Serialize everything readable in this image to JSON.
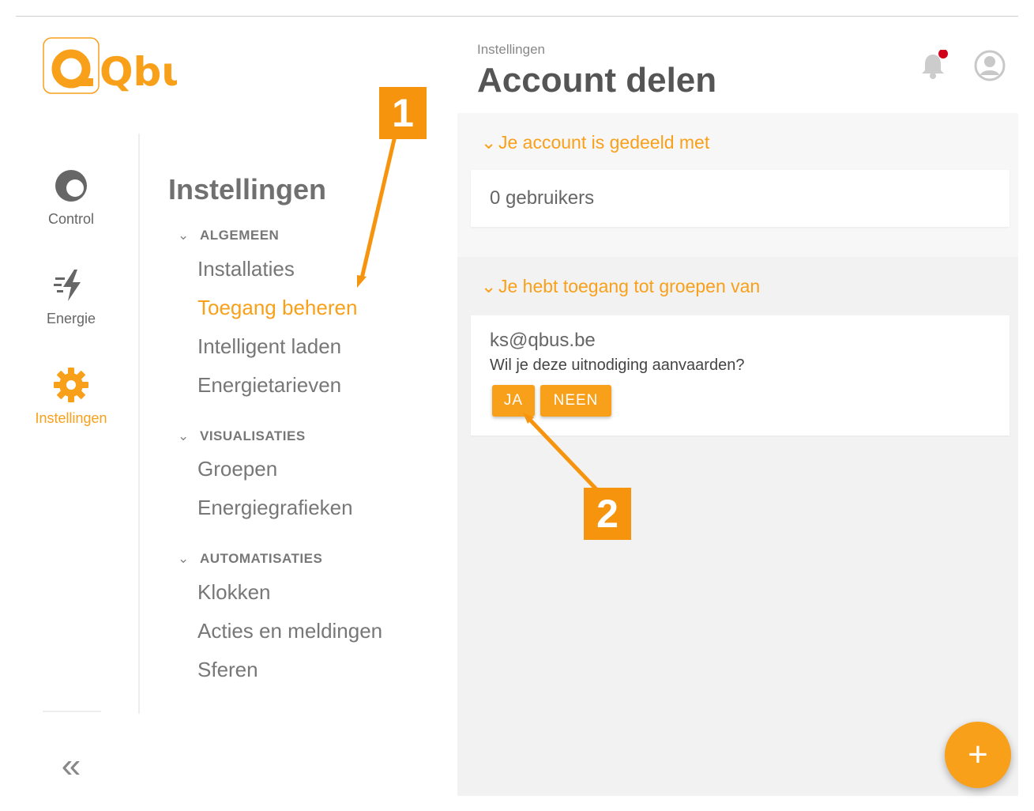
{
  "rail": {
    "logo_text": "Qbus",
    "items": [
      {
        "label": "Control",
        "icon": "control-icon"
      },
      {
        "label": "Energie",
        "icon": "energy-bolt-icon"
      },
      {
        "label": "Instellingen",
        "icon": "gear-icon"
      }
    ],
    "collapse_icon": "double-chevron-left-icon"
  },
  "menu": {
    "title": "Instellingen",
    "sections": [
      {
        "header": "ALGEMEEN",
        "items": [
          "Installaties",
          "Toegang beheren",
          "Intelligent laden",
          "Energietarieven"
        ]
      },
      {
        "header": "VISUALISATIES",
        "items": [
          "Groepen",
          "Energiegrafieken"
        ]
      },
      {
        "header": "AUTOMATISATIES",
        "items": [
          "Klokken",
          "Acties en meldingen",
          "Sferen"
        ]
      }
    ],
    "active_item": "Toegang beheren"
  },
  "panel": {
    "breadcrumb": "Instellingen",
    "title": "Account delen",
    "shared_with": {
      "title": "Je account is gedeeld met",
      "value": "0 gebruikers"
    },
    "access_to": {
      "title": "Je hebt toegang tot groepen van",
      "email": "ks@qbus.be",
      "question": "Wil je deze uitnodiging aanvaarden?",
      "yes_label": "JA",
      "no_label": "NEEN"
    },
    "fab_label": "+"
  },
  "callouts": {
    "one": "1",
    "two": "2"
  },
  "colors": {
    "accent": "#f9a01b",
    "callout": "#f7940e",
    "badge": "#d0021b"
  }
}
